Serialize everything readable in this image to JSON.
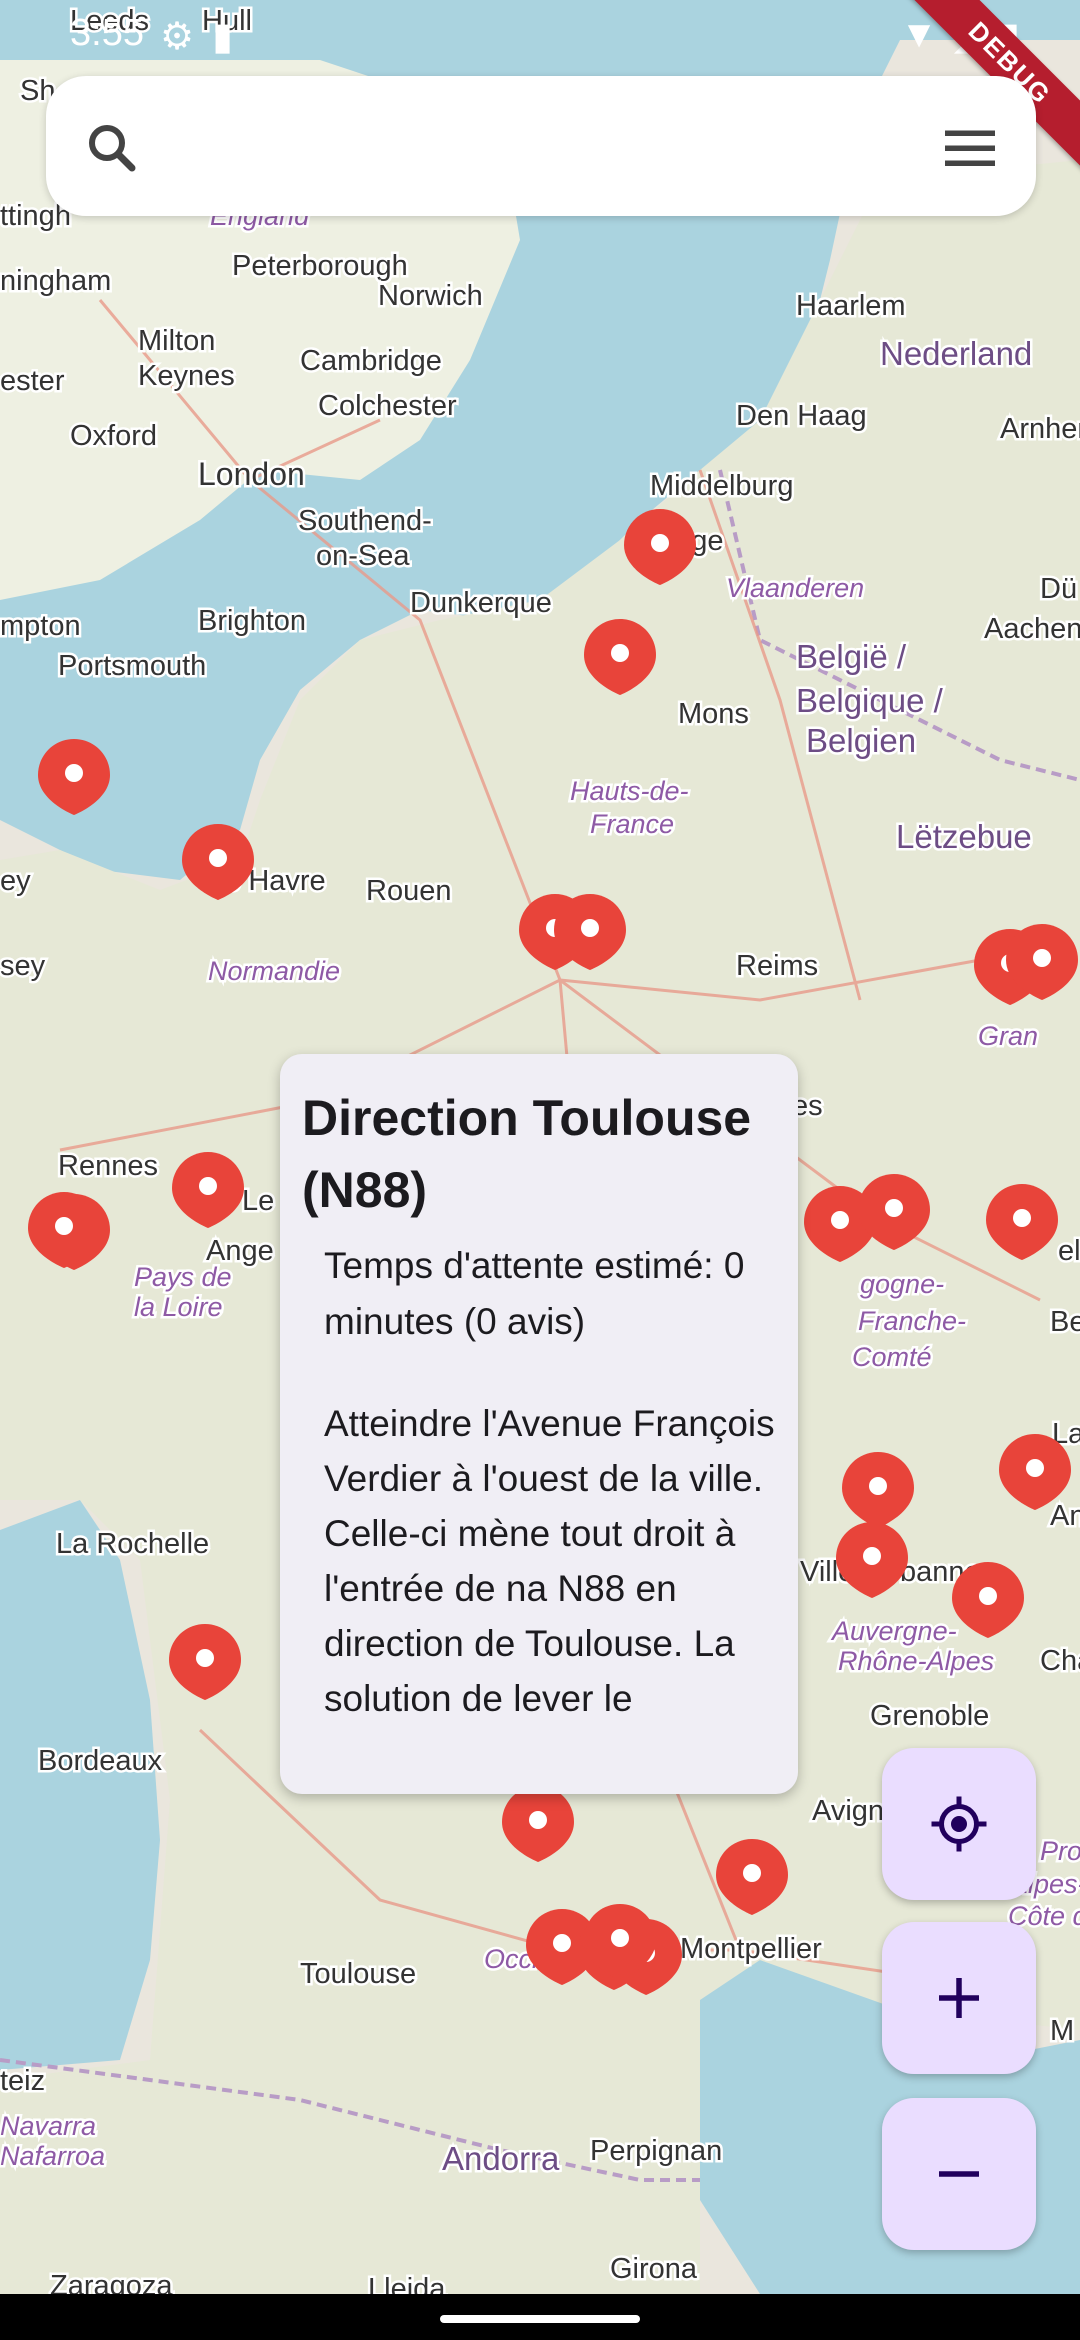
{
  "status": {
    "time": "3:55"
  },
  "debug_banner": "DEBUG",
  "map": {
    "place_labels": [
      {
        "text": "Leeds",
        "kind": "city"
      },
      {
        "text": "Hull",
        "kind": "city"
      },
      {
        "text": "Sh",
        "kind": "city"
      },
      {
        "text": "ttingh",
        "kind": "city"
      },
      {
        "text": "England",
        "kind": "region"
      },
      {
        "text": "ningham",
        "kind": "city"
      },
      {
        "text": "Peterborough",
        "kind": "city"
      },
      {
        "text": "Norwich",
        "kind": "city"
      },
      {
        "text": "Milton",
        "kind": "city"
      },
      {
        "text": "Keynes",
        "kind": "city"
      },
      {
        "text": "Cambridge",
        "kind": "city"
      },
      {
        "text": "ester",
        "kind": "city"
      },
      {
        "text": "Colchester",
        "kind": "city"
      },
      {
        "text": "Oxford",
        "kind": "city"
      },
      {
        "text": "London",
        "kind": "capital"
      },
      {
        "text": "Southend-",
        "kind": "city"
      },
      {
        "text": "on-Sea",
        "kind": "city"
      },
      {
        "text": "Brighton",
        "kind": "city"
      },
      {
        "text": "mpton",
        "kind": "city"
      },
      {
        "text": "Portsmouth",
        "kind": "city"
      },
      {
        "text": "Haarlem",
        "kind": "city"
      },
      {
        "text": "Nederland",
        "kind": "country"
      },
      {
        "text": "Den Haag",
        "kind": "city"
      },
      {
        "text": "Arnhem",
        "kind": "city"
      },
      {
        "text": "Middelburg",
        "kind": "city"
      },
      {
        "text": "Brugge",
        "kind": "city"
      },
      {
        "text": "Vlaanderen",
        "kind": "region"
      },
      {
        "text": "Dunkerque",
        "kind": "city"
      },
      {
        "text": "België /",
        "kind": "country"
      },
      {
        "text": "Belgique /",
        "kind": "country"
      },
      {
        "text": "Belgien",
        "kind": "country"
      },
      {
        "text": "Aachen",
        "kind": "city"
      },
      {
        "text": "Dü",
        "kind": "city"
      },
      {
        "text": "Mons",
        "kind": "city"
      },
      {
        "text": "Hauts-de-",
        "kind": "region"
      },
      {
        "text": "France",
        "kind": "region"
      },
      {
        "text": "Lëtzebue",
        "kind": "country"
      },
      {
        "text": "Le Havre",
        "kind": "city"
      },
      {
        "text": "Rouen",
        "kind": "city"
      },
      {
        "text": "ey",
        "kind": "city"
      },
      {
        "text": "sey",
        "kind": "city"
      },
      {
        "text": "Normandie",
        "kind": "region"
      },
      {
        "text": "Reims",
        "kind": "city"
      },
      {
        "text": "Gran",
        "kind": "region"
      },
      {
        "text": "es",
        "kind": "city"
      },
      {
        "text": "Rennes",
        "kind": "city"
      },
      {
        "text": "Le",
        "kind": "city"
      },
      {
        "text": "Ange",
        "kind": "city"
      },
      {
        "text": "Pays de",
        "kind": "region"
      },
      {
        "text": "la Loire",
        "kind": "region"
      },
      {
        "text": "gogne-",
        "kind": "region"
      },
      {
        "text": "Franche-",
        "kind": "region"
      },
      {
        "text": "Comté",
        "kind": "region"
      },
      {
        "text": "elf",
        "kind": "city"
      },
      {
        "text": "Bes",
        "kind": "city"
      },
      {
        "text": "Lau",
        "kind": "city"
      },
      {
        "text": "An",
        "kind": "city"
      },
      {
        "text": "La Rochelle",
        "kind": "city"
      },
      {
        "text": "Ville",
        "kind": "city"
      },
      {
        "text": "banne",
        "kind": "city"
      },
      {
        "text": "Auvergne-",
        "kind": "region"
      },
      {
        "text": "Rhône-Alpes",
        "kind": "region"
      },
      {
        "text": "Char",
        "kind": "city"
      },
      {
        "text": "Grenoble",
        "kind": "city"
      },
      {
        "text": "Bordeaux",
        "kind": "city"
      },
      {
        "text": "Avignon",
        "kind": "city"
      },
      {
        "text": "Prove",
        "kind": "region"
      },
      {
        "text": "Alpes-",
        "kind": "region"
      },
      {
        "text": "Côte d'Azu",
        "kind": "region"
      },
      {
        "text": "Toulouse",
        "kind": "city"
      },
      {
        "text": "Occitanie",
        "kind": "region"
      },
      {
        "text": "Montpellier",
        "kind": "city"
      },
      {
        "text": "M",
        "kind": "city"
      },
      {
        "text": "teiz",
        "kind": "city"
      },
      {
        "text": "Navarra",
        "kind": "region"
      },
      {
        "text": "Nafarroa",
        "kind": "region"
      },
      {
        "text": "Andorra",
        "kind": "country"
      },
      {
        "text": "Perpignan",
        "kind": "city"
      },
      {
        "text": "Zaragoza",
        "kind": "city"
      },
      {
        "text": "Lleida",
        "kind": "city"
      },
      {
        "text": "Girona",
        "kind": "city"
      }
    ],
    "marker_count": 33,
    "marker_color": "#e8443a"
  },
  "popup": {
    "title": "Direction Toulouse (N88)",
    "wait_time": "Temps d'attente estimé: 0 minutes (0 avis)",
    "description": "Atteindre l'Avenue François Verdier à l'ouest de la ville. Celle-ci mène tout droit à l'entrée de na N88 en direction de Toulouse. La solution de lever le"
  },
  "controls": {
    "locate_icon": "my-location-icon",
    "zoom_in_icon": "plus-icon",
    "zoom_out_icon": "minus-icon",
    "fab_color": "#eaddff",
    "icon_color": "#21005d"
  }
}
